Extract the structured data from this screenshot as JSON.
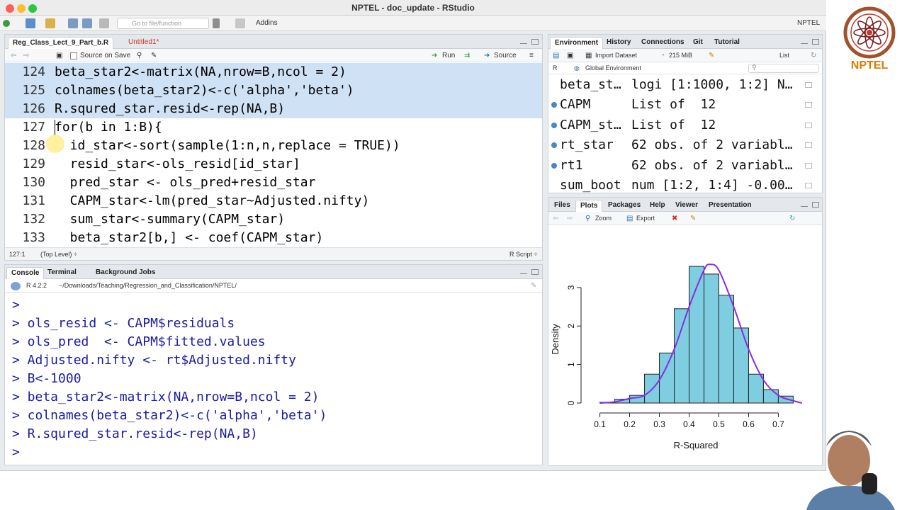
{
  "window": {
    "title": "NPTEL - doc_update - RStudio"
  },
  "toolbar": {
    "goto_placeholder": "Go to file/function",
    "addins": "Addins",
    "project": "NPTEL"
  },
  "editor": {
    "tabs": [
      {
        "label": "Reg_Class_Lect_9_Part_b.R"
      },
      {
        "label": "Untitled1*"
      }
    ],
    "source_on_save": "Source on Save",
    "run": "Run",
    "source": "Source",
    "lines": [
      {
        "num": "124",
        "code": "beta_star2<-matrix(NA,nrow=B,ncol = 2)"
      },
      {
        "num": "125",
        "code": "colnames(beta_star2)<-c('alpha','beta')"
      },
      {
        "num": "126",
        "code": "R.squred_star.resid<-rep(NA,B)"
      },
      {
        "num": "127",
        "code": "for(b in 1:B){"
      },
      {
        "num": "128",
        "code": "  id_star<-sort(sample(1:n,n,replace = TRUE))"
      },
      {
        "num": "129",
        "code": "  resid_star<-ols_resid[id_star]"
      },
      {
        "num": "130",
        "code": "  pred_star <- ols_pred+resid_star"
      },
      {
        "num": "131",
        "code": "  CAPM_star<-lm(pred_star~Adjusted.nifty)"
      },
      {
        "num": "132",
        "code": "  sum_star<-summary(CAPM_star)"
      },
      {
        "num": "133",
        "code": "  beta_star2[b,] <- coef(CAPM_star)"
      }
    ],
    "status_pos": "127:1",
    "status_scope": "(Top Level) ÷",
    "status_type": "R Script ÷"
  },
  "console": {
    "tabs": [
      {
        "label": "Console"
      },
      {
        "label": "Terminal"
      },
      {
        "label": "Background Jobs"
      }
    ],
    "r_version": "R 4.2.2",
    "path": "~/Downloads/Teaching/Regression_and_Classification/NPTEL/",
    "lines": [
      ">",
      "> ols_resid <- CAPM$residuals",
      "> ols_pred  <- CAPM$fitted.values",
      "> Adjusted.nifty <- rt$Adjusted.nifty",
      "> B<-1000",
      "> beta_star2<-matrix(NA,nrow=B,ncol = 2)",
      "> colnames(beta_star2)<-c('alpha','beta')",
      "> R.squred_star.resid<-rep(NA,B)",
      ">"
    ]
  },
  "environment": {
    "tabs": [
      {
        "label": "Environment"
      },
      {
        "label": "History"
      },
      {
        "label": "Connections"
      },
      {
        "label": "Git"
      },
      {
        "label": "Tutorial"
      }
    ],
    "import_dataset": "Import Dataset",
    "memory": "215 MiB",
    "view_mode": "List",
    "lang": "R",
    "scope": "Global Environment",
    "rows": [
      {
        "name": "beta_st…",
        "value": "logi [1:1000, 1:2] N…",
        "expand": false
      },
      {
        "name": "CAPM",
        "value": "List of  12",
        "expand": true
      },
      {
        "name": "CAPM_st…",
        "value": "List of  12",
        "expand": true
      },
      {
        "name": "rt_star",
        "value": "62 obs. of 2 variabl…",
        "expand": true
      },
      {
        "name": "rt1",
        "value": "62 obs. of 2 variabl…",
        "expand": true
      },
      {
        "name": "sum_boot",
        "value": "num [1:2, 1:4] -0.00…",
        "expand": false
      }
    ]
  },
  "files": {
    "tabs": [
      {
        "label": "Files"
      },
      {
        "label": "Plots"
      },
      {
        "label": "Packages"
      },
      {
        "label": "Help"
      },
      {
        "label": "Viewer"
      },
      {
        "label": "Presentation"
      }
    ],
    "zoom": "Zoom",
    "export": "Export"
  },
  "logo": {
    "text": "NPTEL"
  },
  "chart_data": {
    "type": "bar",
    "xlabel": "R-Squared",
    "ylabel": "Density",
    "xlim": [
      0.07,
      0.78
    ],
    "ylim": [
      0,
      3.9
    ],
    "x_ticks": [
      0.1,
      0.2,
      0.3,
      0.4,
      0.5,
      0.6,
      0.7
    ],
    "y_ticks": [
      0,
      1,
      2,
      3
    ],
    "bin_width": 0.05,
    "bins": [
      0.15,
      0.2,
      0.25,
      0.3,
      0.35,
      0.4,
      0.45,
      0.5,
      0.55,
      0.6,
      0.65,
      0.7,
      0.75
    ],
    "values": [
      0.02,
      0.1,
      0.2,
      0.75,
      1.3,
      2.45,
      3.55,
      3.35,
      2.8,
      1.95,
      0.75,
      0.35,
      0.18
    ],
    "density_curve": {
      "x": [
        0.1,
        0.15,
        0.2,
        0.25,
        0.3,
        0.35,
        0.4,
        0.45,
        0.47,
        0.5,
        0.55,
        0.6,
        0.65,
        0.7,
        0.75,
        0.78
      ],
      "y": [
        0.0,
        0.03,
        0.12,
        0.2,
        0.6,
        1.4,
        2.5,
        3.45,
        3.6,
        3.45,
        2.5,
        1.4,
        0.6,
        0.2,
        0.06,
        0.0
      ]
    },
    "bar_color": "#7ecde0",
    "curve_color": "#8a2be2",
    "grid": false
  }
}
